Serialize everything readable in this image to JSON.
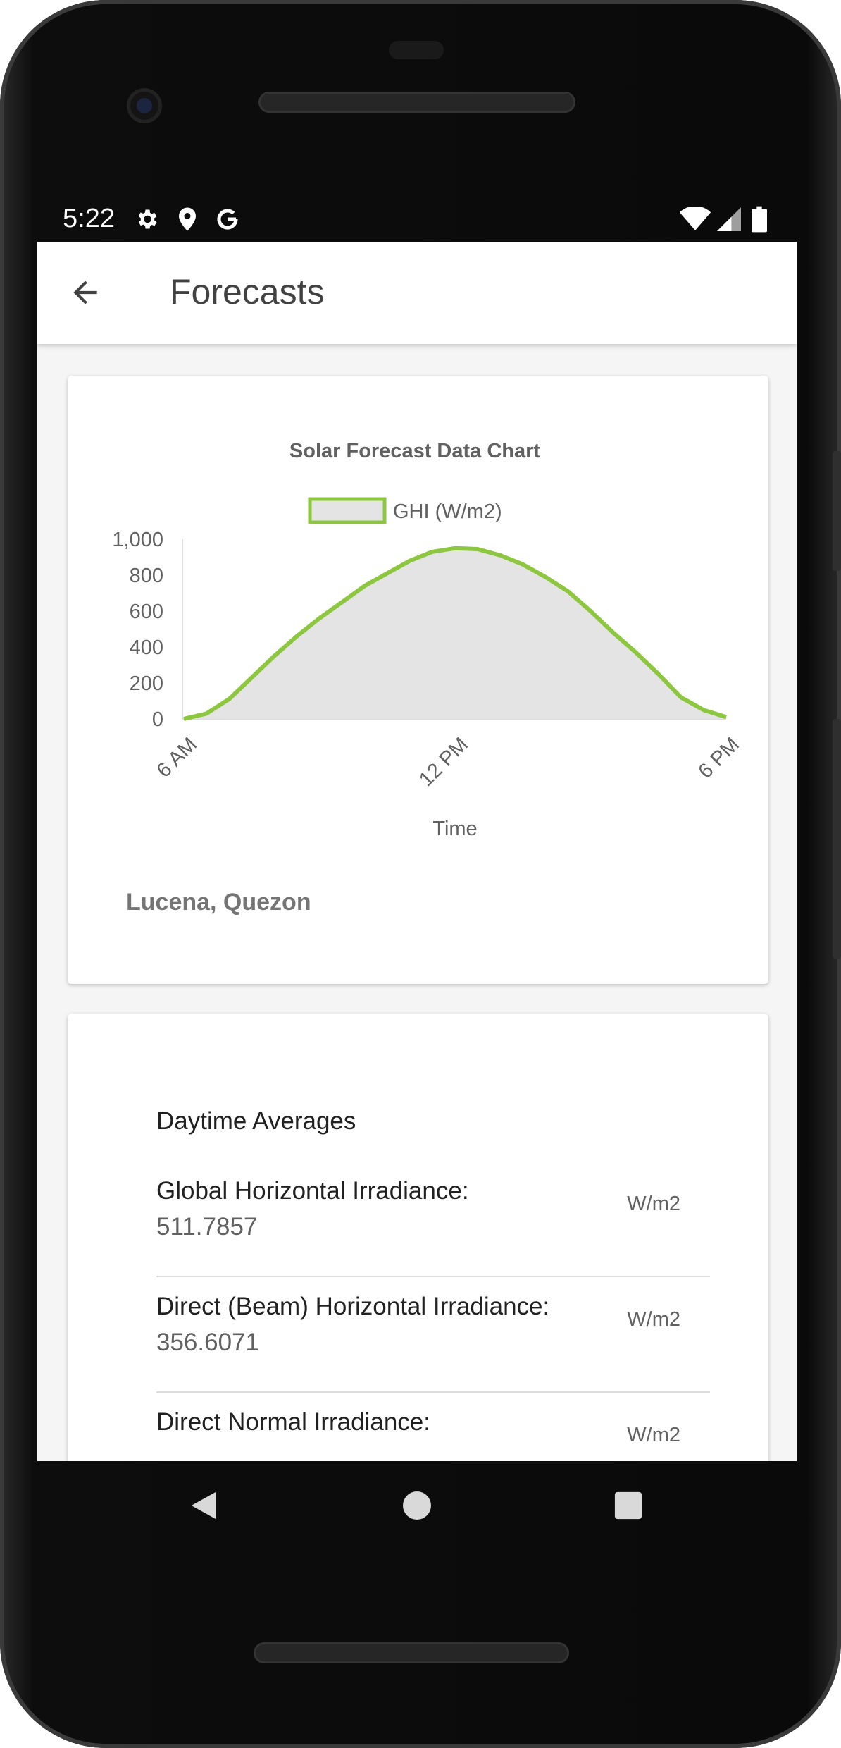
{
  "status_bar": {
    "time": "5:22"
  },
  "app_bar": {
    "title": "Forecasts"
  },
  "chart_data": {
    "type": "area",
    "title": "Solar Forecast Data Chart",
    "xlabel": "Time",
    "ylabel": "",
    "x_tick_labels": [
      "6 AM",
      "12 PM",
      "6 PM"
    ],
    "y_tick_labels": [
      "1,000",
      "800",
      "600",
      "400",
      "200",
      "0"
    ],
    "ylim": [
      0,
      1000
    ],
    "legend_position": "top",
    "grid": false,
    "series": [
      {
        "name": "GHI (W/m2)",
        "color": "#8dc63f",
        "fill": "#e4e4e4",
        "x_hours": [
          6,
          6.5,
          7,
          7.5,
          8,
          8.5,
          9,
          9.5,
          10,
          10.5,
          11,
          11.5,
          12,
          12.5,
          13,
          13.5,
          14,
          14.5,
          15,
          15.5,
          16,
          16.5,
          17,
          17.5,
          18
        ],
        "values": [
          0,
          30,
          110,
          230,
          350,
          460,
          560,
          650,
          740,
          810,
          880,
          930,
          950,
          945,
          910,
          860,
          790,
          710,
          600,
          480,
          370,
          250,
          120,
          50,
          10
        ]
      }
    ]
  },
  "chart_card": {
    "location": "Lucena, Quezon"
  },
  "averages": {
    "heading": "Daytime Averages",
    "rows": [
      {
        "label": "Global Horizontal Irradiance:",
        "value": "511.7857",
        "unit": "W/m2"
      },
      {
        "label": "Direct (Beam) Horizontal Irradiance:",
        "value": "356.6071",
        "unit": "W/m2"
      },
      {
        "label": "Direct Normal Irradiance:",
        "value": "",
        "unit": "W/m2"
      }
    ]
  }
}
